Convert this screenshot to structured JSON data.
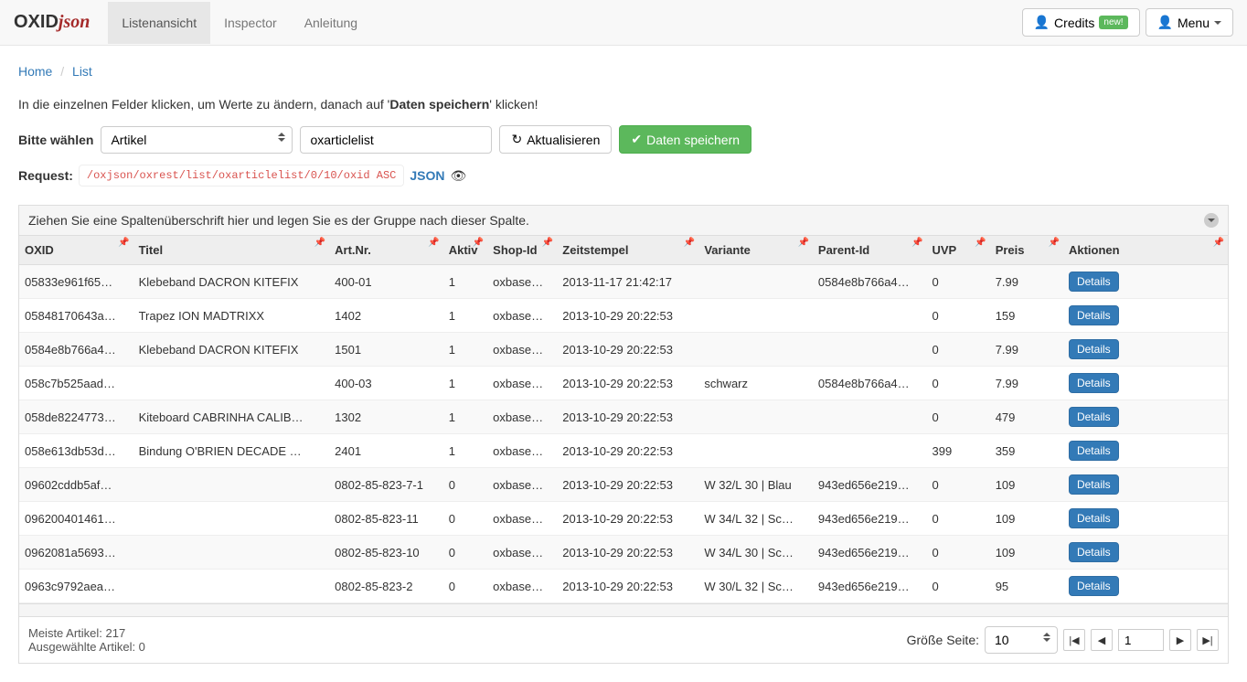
{
  "brand": {
    "part1": "OXID",
    "part2": "json"
  },
  "nav": {
    "tabs": [
      {
        "label": "Listenansicht",
        "active": true
      },
      {
        "label": "Inspector",
        "active": false
      },
      {
        "label": "Anleitung",
        "active": false
      }
    ],
    "right": {
      "credits_label": "Credits",
      "credits_badge": "new!",
      "menu_label": "Menu"
    }
  },
  "breadcrumb": {
    "home": "Home",
    "list": "List"
  },
  "help": {
    "prefix": "In die einzelnen Felder klicken, um Werte zu ändern, danach auf '",
    "bold": "Daten speichern",
    "suffix": "' klicken!"
  },
  "controls": {
    "select_label": "Bitte wählen",
    "entity_value": "Artikel",
    "list_input_value": "oxarticlelist",
    "refresh_label": "Aktualisieren",
    "save_label": "Daten speichern"
  },
  "request": {
    "label": "Request:",
    "url": "/oxjson/oxrest/list/oxarticlelist/0/10/oxid ASC",
    "json_label": "JSON"
  },
  "grid": {
    "group_hint": "Ziehen Sie eine Spaltenüberschrift hier und legen Sie es der Gruppe nach dieser Spalte.",
    "columns": [
      "OXID",
      "Titel",
      "Art.Nr.",
      "Aktiv",
      "Shop-Id",
      "Zeitstempel",
      "Variante",
      "Parent-Id",
      "UVP",
      "Preis",
      "Aktionen"
    ],
    "detail_label": "Details",
    "rows": [
      {
        "oxid": "05833e961f65…",
        "titel": "Klebeband DACRON KITEFIX",
        "artnr": "400-01",
        "aktiv": "1",
        "shopid": "oxbase…",
        "ts": "2013-11-17 21:42:17",
        "variante": "",
        "parentid": "0584e8b766a4…",
        "uvp": "0",
        "preis": "7.99"
      },
      {
        "oxid": "05848170643a…",
        "titel": "Trapez ION MADTRIXX",
        "artnr": "1402",
        "aktiv": "1",
        "shopid": "oxbase…",
        "ts": "2013-10-29 20:22:53",
        "variante": "",
        "parentid": "",
        "uvp": "0",
        "preis": "159"
      },
      {
        "oxid": "0584e8b766a4…",
        "titel": "Klebeband DACRON KITEFIX",
        "artnr": "1501",
        "aktiv": "1",
        "shopid": "oxbase…",
        "ts": "2013-10-29 20:22:53",
        "variante": "",
        "parentid": "",
        "uvp": "0",
        "preis": "7.99"
      },
      {
        "oxid": "058c7b525aad…",
        "titel": "",
        "artnr": "400-03",
        "aktiv": "1",
        "shopid": "oxbase…",
        "ts": "2013-10-29 20:22:53",
        "variante": "schwarz",
        "parentid": "0584e8b766a4…",
        "uvp": "0",
        "preis": "7.99"
      },
      {
        "oxid": "058de8224773…",
        "titel": "Kiteboard CABRINHA CALIB…",
        "artnr": "1302",
        "aktiv": "1",
        "shopid": "oxbase…",
        "ts": "2013-10-29 20:22:53",
        "variante": "",
        "parentid": "",
        "uvp": "0",
        "preis": "479"
      },
      {
        "oxid": "058e613db53d…",
        "titel": "Bindung O'BRIEN DECADE …",
        "artnr": "2401",
        "aktiv": "1",
        "shopid": "oxbase…",
        "ts": "2013-10-29 20:22:53",
        "variante": "",
        "parentid": "",
        "uvp": "399",
        "preis": "359"
      },
      {
        "oxid": "09602cddb5af…",
        "titel": "",
        "artnr": "0802-85-823-7-1",
        "aktiv": "0",
        "shopid": "oxbase…",
        "ts": "2013-10-29 20:22:53",
        "variante": "W 32/L 30 | Blau",
        "parentid": "943ed656e219…",
        "uvp": "0",
        "preis": "109"
      },
      {
        "oxid": "096200401461…",
        "titel": "",
        "artnr": "0802-85-823-11",
        "aktiv": "0",
        "shopid": "oxbase…",
        "ts": "2013-10-29 20:22:53",
        "variante": "W 34/L 32 | Sc…",
        "parentid": "943ed656e219…",
        "uvp": "0",
        "preis": "109"
      },
      {
        "oxid": "0962081a5693…",
        "titel": "",
        "artnr": "0802-85-823-10",
        "aktiv": "0",
        "shopid": "oxbase…",
        "ts": "2013-10-29 20:22:53",
        "variante": "W 34/L 30 | Sc…",
        "parentid": "943ed656e219…",
        "uvp": "0",
        "preis": "109"
      },
      {
        "oxid": "0963c9792aea…",
        "titel": "",
        "artnr": "0802-85-823-2",
        "aktiv": "0",
        "shopid": "oxbase…",
        "ts": "2013-10-29 20:22:53",
        "variante": "W 30/L 32 | Sc…",
        "parentid": "943ed656e219…",
        "uvp": "0",
        "preis": "95"
      }
    ],
    "footer": {
      "total_label": "Meiste Artikel: 217",
      "selected_label": "Ausgewählte Artikel: 0",
      "page_size_label": "Größe Seite:",
      "page_size_value": "10",
      "page_value": "1"
    }
  }
}
